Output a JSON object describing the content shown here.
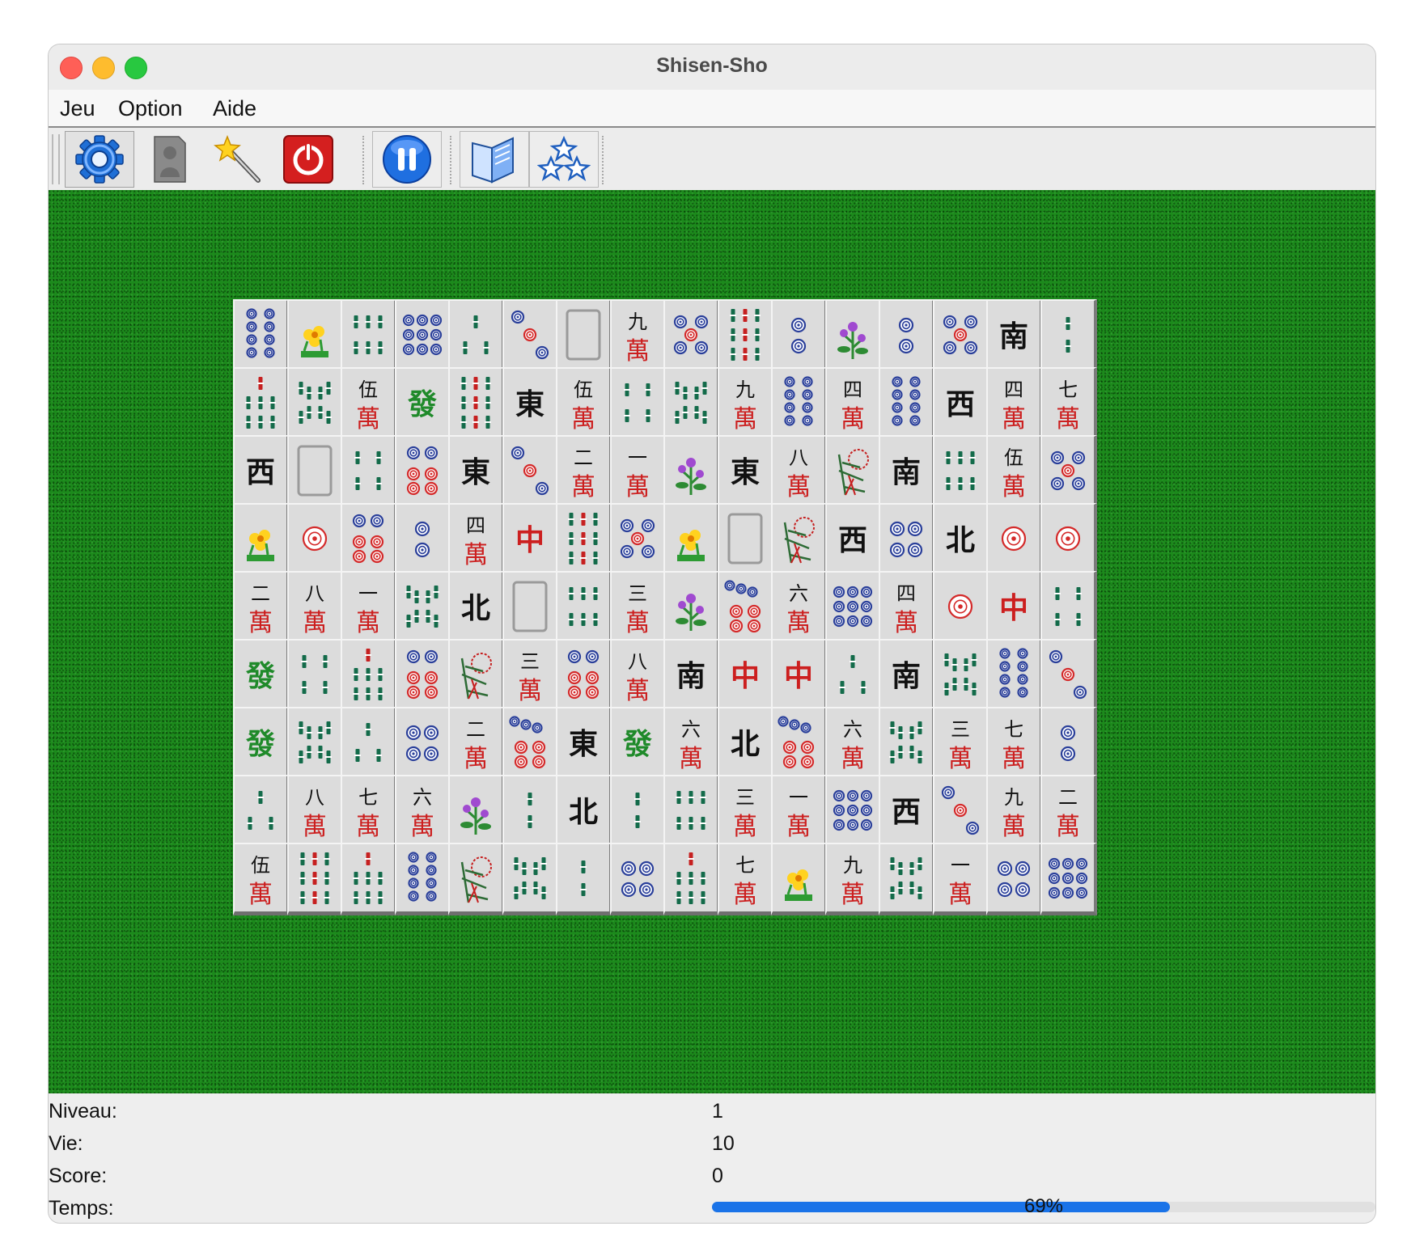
{
  "window": {
    "title": "Shisen-Sho"
  },
  "menu": [
    "Jeu",
    "Option",
    "Aide"
  ],
  "toolbar": [
    {
      "name": "settings-button",
      "icon": "gear-icon"
    },
    {
      "name": "hint-button",
      "icon": "figure-icon"
    },
    {
      "name": "magic-button",
      "icon": "magic-wand-icon"
    },
    {
      "name": "quit-button",
      "icon": "power-icon"
    },
    {
      "name": "pause-button",
      "icon": "pause-icon"
    },
    {
      "name": "help-button",
      "icon": "book-icon"
    },
    {
      "name": "scores-button",
      "icon": "stars-icon"
    }
  ],
  "board": {
    "rows": 9,
    "cols": 16,
    "tiles": [
      [
        "p8",
        "fYellow",
        "b6",
        "p9",
        "b3",
        "p3",
        "wWhite",
        "c9",
        "p5",
        "b9",
        "p2",
        "fPurple",
        "p2",
        "p5",
        "wS",
        "b2"
      ],
      [
        "b7",
        "b8",
        "c5",
        "wG",
        "b9",
        "wE",
        "c5",
        "b4",
        "b8",
        "c9",
        "p8",
        "c4",
        "p8",
        "wW",
        "c4",
        "c7"
      ],
      [
        "wW",
        "wWhite",
        "b4",
        "p6",
        "wE",
        "p3",
        "c2",
        "c1",
        "fPurple",
        "wE",
        "c8",
        "fRed",
        "wS",
        "b6",
        "c5",
        "p5"
      ],
      [
        "fYellow",
        "p1",
        "p6",
        "p2",
        "c4",
        "wR",
        "b9",
        "p5",
        "fYellow",
        "wWhite",
        "fRed",
        "wW",
        "p4",
        "wN",
        "p1",
        "p1"
      ],
      [
        "c2",
        "c8",
        "c1",
        "b8",
        "wN",
        "wWhite",
        "b6",
        "c3",
        "fPurple",
        "p7",
        "c6",
        "p9",
        "c4",
        "p1",
        "wR",
        "b4"
      ],
      [
        "wG",
        "b4",
        "b7",
        "p6",
        "fRed",
        "c3",
        "p6",
        "c8",
        "wS",
        "wR",
        "wR",
        "b3",
        "wS",
        "b8",
        "p8",
        "p3"
      ],
      [
        "wG",
        "b8",
        "b3",
        "p4",
        "c2",
        "p7",
        "wE",
        "wG",
        "c6",
        "wN",
        "p7",
        "c6",
        "b8",
        "c3",
        "c7",
        "p2"
      ],
      [
        "b3",
        "c8",
        "c7",
        "c6",
        "fPurple",
        "b2",
        "wN",
        "b2",
        "b6",
        "c3",
        "c1",
        "p9",
        "wW",
        "p3",
        "c9",
        "c2"
      ],
      [
        "c5",
        "b9",
        "b7",
        "p8",
        "fRed",
        "b8",
        "b2",
        "p4",
        "b7",
        "c7",
        "fYellow",
        "c9",
        "b8",
        "c1",
        "p4",
        "p9"
      ]
    ]
  },
  "status": {
    "level_label": "Niveau:",
    "level_value": "1",
    "life_label": "Vie:",
    "life_value": "10",
    "score_label": "Score:",
    "score_value": "0",
    "time_label": "Temps:",
    "time_text": "69%",
    "time_fraction": 0.69
  },
  "colors": {
    "felt": "#1c8a1c",
    "progress": "#1a73e8"
  }
}
